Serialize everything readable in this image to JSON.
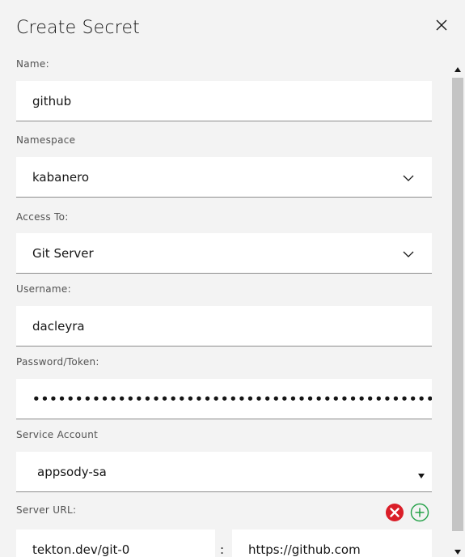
{
  "modal": {
    "title": "Create Secret",
    "close_icon": "close-icon"
  },
  "form": {
    "name": {
      "label": "Name:",
      "value": "github"
    },
    "namespace": {
      "label": "Namespace",
      "value": "kabanero",
      "icon": "chevron-down-icon"
    },
    "access_to": {
      "label": "Access To:",
      "value": "Git Server",
      "icon": "chevron-down-icon"
    },
    "username": {
      "label": "Username:",
      "value": "dacleyra"
    },
    "password": {
      "label": "Password/Token:",
      "value": "••••••••••••••••••••••••••••••••••••••••••••••••••••••••••••••"
    },
    "service_account": {
      "label": "Service Account",
      "value": "appsody-sa",
      "icon": "caret-down-icon"
    },
    "server_url": {
      "label": "Server URL:",
      "key_value": "tekton.dev/git-0",
      "separator": ":",
      "url_value": "https://github.com",
      "remove_icon": "remove-circle-icon",
      "add_icon": "add-circle-icon"
    }
  },
  "colors": {
    "background": "#f3f3f3",
    "field_background": "#ffffff",
    "remove_red": "#da1e28",
    "add_green": "#24a148"
  }
}
